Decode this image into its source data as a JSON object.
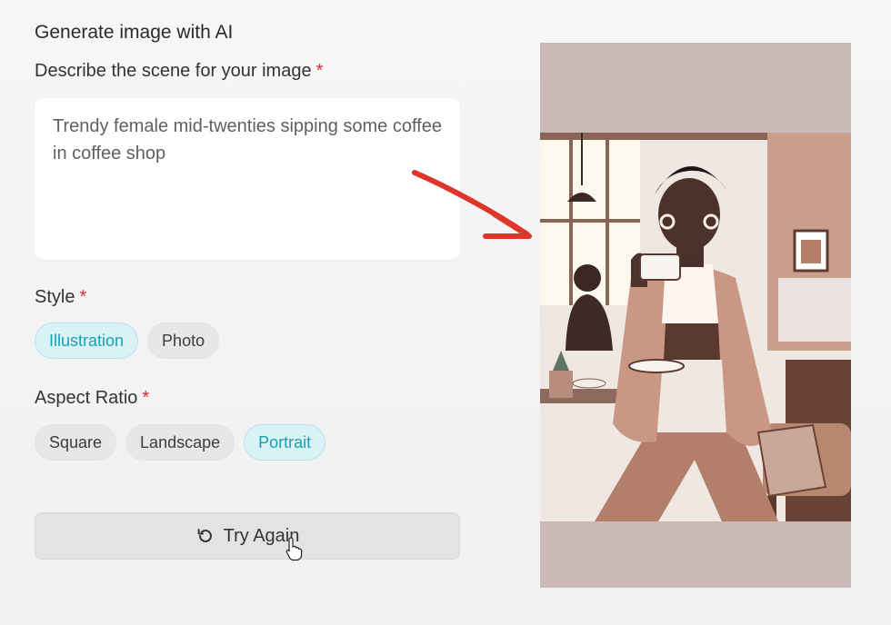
{
  "form": {
    "title": "Generate image with AI",
    "prompt_label": "Describe the scene for your image",
    "required_marker": "*",
    "prompt_value": "Trendy female mid-twenties sipping some coffee in coffee shop",
    "style_label": "Style",
    "style_options": [
      "Illustration",
      "Photo"
    ],
    "style_selected": "Illustration",
    "aspect_label": "Aspect Ratio",
    "aspect_options": [
      "Square",
      "Landscape",
      "Portrait"
    ],
    "aspect_selected": "Portrait",
    "try_again_label": "Try Again"
  },
  "icons": {
    "try_again": "refresh-icon",
    "arrow": "red-arrow-icon",
    "cursor": "hand-pointer-icon"
  },
  "colors": {
    "accent": "#18a0b4",
    "accent_bg": "#d9f2f6",
    "required": "#d62d2d",
    "arrow": "#e0352b",
    "preview_bg": "#cab9b6"
  }
}
